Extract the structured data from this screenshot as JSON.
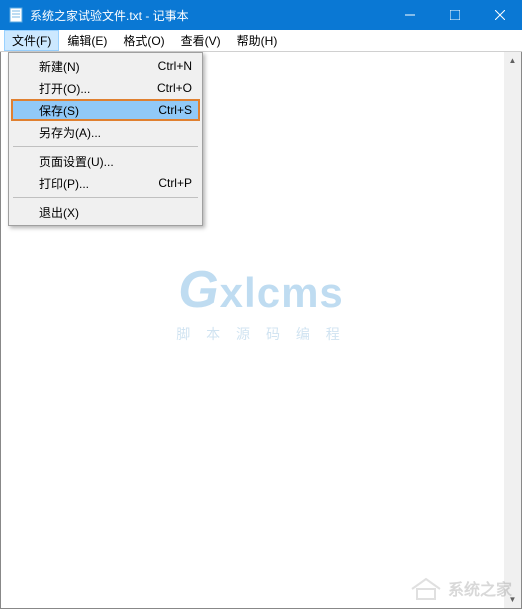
{
  "title": "系统之家试验文件.txt - 记事本",
  "menubar": {
    "file": "文件(F)",
    "edit": "编辑(E)",
    "format": "格式(O)",
    "view": "查看(V)",
    "help": "帮助(H)"
  },
  "file_menu": {
    "new": {
      "label": "新建(N)",
      "shortcut": "Ctrl+N"
    },
    "open": {
      "label": "打开(O)...",
      "shortcut": "Ctrl+O"
    },
    "save": {
      "label": "保存(S)",
      "shortcut": "Ctrl+S"
    },
    "saveas": {
      "label": "另存为(A)...",
      "shortcut": ""
    },
    "pagesetup": {
      "label": "页面设置(U)...",
      "shortcut": ""
    },
    "print": {
      "label": "打印(P)...",
      "shortcut": "Ctrl+P"
    },
    "exit": {
      "label": "退出(X)",
      "shortcut": ""
    }
  },
  "watermark": {
    "logo": "Gxlcms",
    "tagline": "脚 本  源 码  编 程",
    "corner": "系统之家"
  }
}
